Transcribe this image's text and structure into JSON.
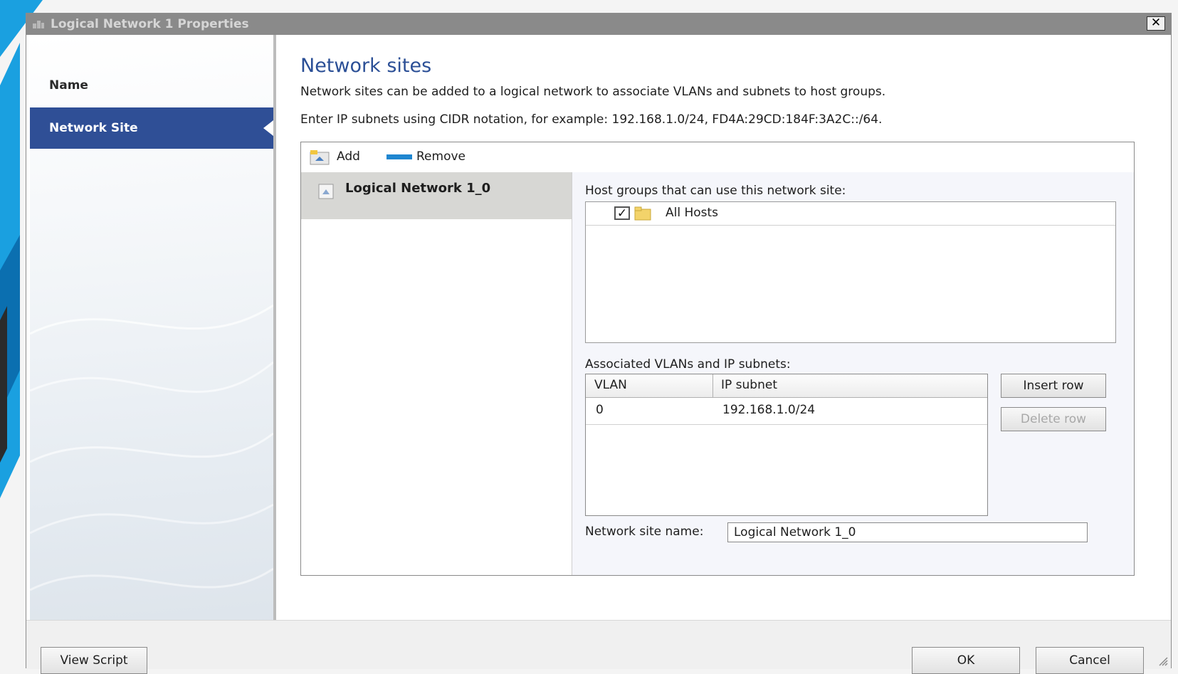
{
  "window": {
    "title": "Logical Network 1 Properties",
    "close_symbol": "✕"
  },
  "nav": {
    "items": [
      {
        "label": "Name",
        "selected": false
      },
      {
        "label": "Network Site",
        "selected": true
      }
    ]
  },
  "main": {
    "title": "Network sites",
    "description1": "Network sites can be added to a logical network to associate VLANs and subnets to host groups.",
    "description2": "Enter IP subnets using CIDR notation, for example: 192.168.1.0/24, FD4A:29CD:184F:3A2C::/64."
  },
  "toolbar": {
    "add_label": "Add",
    "remove_label": "Remove"
  },
  "sites": [
    {
      "name": "Logical Network 1_0",
      "selected": true
    }
  ],
  "host_groups": {
    "label": "Host groups that can use this network site:",
    "items": [
      {
        "name": "All Hosts",
        "checked": true
      }
    ]
  },
  "vlans": {
    "label": "Associated VLANs and IP subnets:",
    "columns": [
      "VLAN",
      "IP subnet"
    ],
    "rows": [
      {
        "vlan": "0",
        "subnet": "192.168.1.0/24"
      }
    ],
    "insert_label": "Insert row",
    "delete_label": "Delete row"
  },
  "site_name": {
    "label": "Network site name:",
    "value": "Logical Network 1_0"
  },
  "footer": {
    "view_script": "View Script",
    "ok": "OK",
    "cancel": "Cancel"
  },
  "colors": {
    "accent": "#2f4f96",
    "title_bar": "#8a8a8a",
    "remove_icon": "#1f86d0"
  },
  "icons": {
    "title": "network-icon",
    "add": "add-site-icon",
    "remove": "remove-bar-icon",
    "site": "network-site-icon",
    "host_group": "folder-icon"
  }
}
